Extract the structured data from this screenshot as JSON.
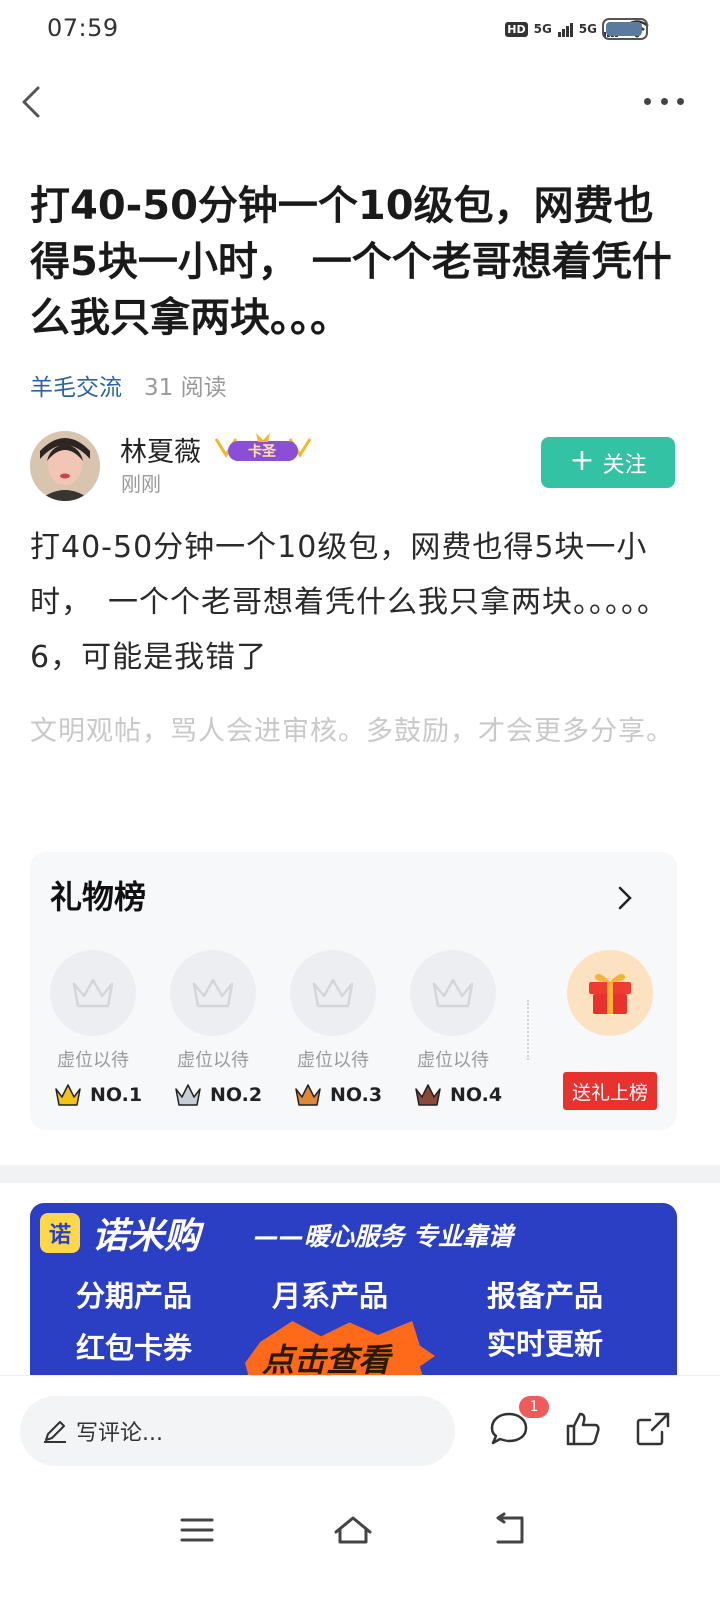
{
  "status_bar": {
    "time": "07:59",
    "network_1": "5G",
    "network_2": "5G"
  },
  "post": {
    "title": "打40-50分钟一个10级包，网费也得5块一小时， 一个个老哥想着凭什么我只拿两块。。。",
    "category": "羊毛交流",
    "read_count": "31 阅读",
    "body": "打40-50分钟一个10级包，网费也得5块一小时，　一个个老哥想着凭什么我只拿两块。。。。。6，可能是我错了",
    "hint": "文明观帖，骂人会进审核。多鼓励，才会更多分享。"
  },
  "author": {
    "name": "林夏薇",
    "badge": "卡圣",
    "time": "刚刚",
    "follow_label": "关注"
  },
  "gift_board": {
    "title": "礼物榜",
    "slots": [
      {
        "label": "虚位以待",
        "rank": "NO.1",
        "crown_color": "#f3c316"
      },
      {
        "label": "虚位以待",
        "rank": "NO.2",
        "crown_color": "#9aa3ad"
      },
      {
        "label": "虚位以待",
        "rank": "NO.3",
        "crown_color": "#e0883a"
      },
      {
        "label": "虚位以待",
        "rank": "NO.4",
        "crown_color": "#8a4a3a"
      }
    ],
    "send_label": "送礼上榜"
  },
  "ad": {
    "logo": "诺",
    "brand": "诺米购",
    "slogan": "——暖心服务 专业靠谱",
    "items": [
      "分期产品",
      "月系产品",
      "报备产品",
      "红包卡券",
      "实时更新"
    ],
    "cta": "点击查看"
  },
  "bottom_bar": {
    "comment_placeholder": "写评论...",
    "comment_badge": "1"
  },
  "colors": {
    "accent": "#33c2a3",
    "category": "#2d63a6",
    "gift_button": "#e8322e",
    "ad_background": "#2b3fc4"
  }
}
